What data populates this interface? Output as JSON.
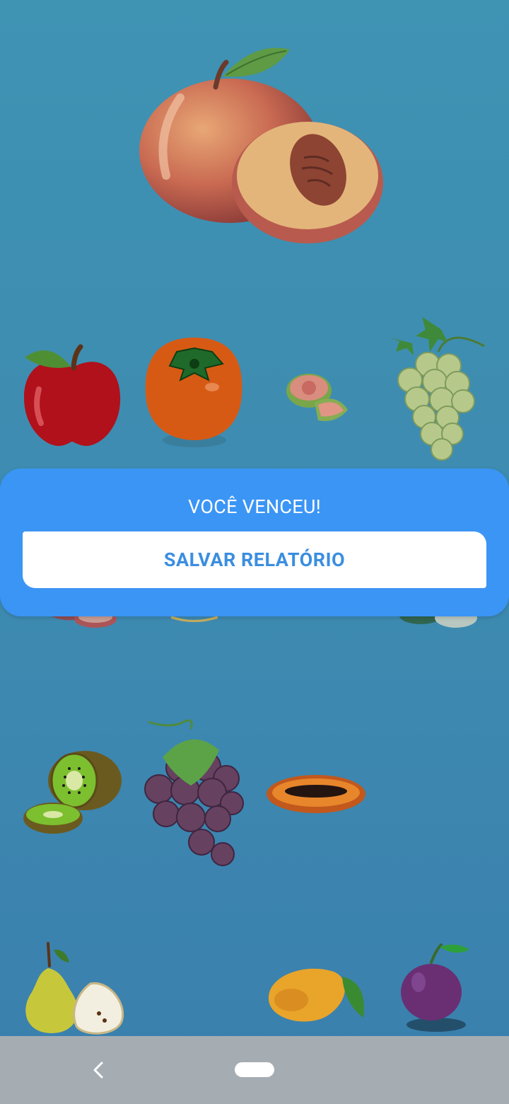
{
  "dialog": {
    "title": "VOCÊ VENCEU!",
    "button_label": "SALVAR RELATÓRIO"
  },
  "colors": {
    "background": "#3f93b3",
    "dialog": "#3b95f5",
    "button_text": "#3b8ee0",
    "navbar": "#a6adb2"
  },
  "fruits": [
    "peach",
    "apple",
    "persimmon",
    "guava",
    "green-grapes",
    "kiwi",
    "purple-grapes",
    "papaya",
    "pear",
    "mango",
    "plum"
  ],
  "navbar": {
    "icons": [
      "back-icon",
      "home-pill-icon"
    ]
  }
}
